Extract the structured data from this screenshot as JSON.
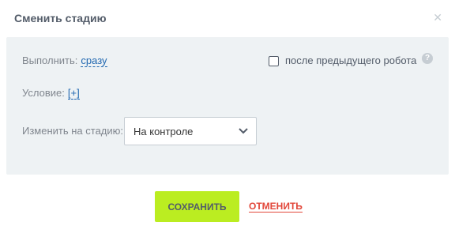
{
  "dialog": {
    "title": "Сменить стадию",
    "close_icon": "close-icon"
  },
  "panel": {
    "execute_label": "Выполнить:",
    "execute_value": "сразу",
    "after_robot_label": "после предыдущего робота",
    "after_robot_checked": false,
    "help_icon": "question-circle-icon",
    "help_glyph": "?",
    "condition_label": "Условие:",
    "condition_value": "[+]",
    "stage_label": "Изменить на стадию:",
    "stage_selected": "На контроле"
  },
  "footer": {
    "save_label": "СОХРАНИТЬ",
    "cancel_label": "ОТМЕНИТЬ"
  },
  "colors": {
    "save_button_bg": "#bbed21",
    "cancel_link": "#e2473a",
    "link_blue": "#2067b0",
    "panel_bg": "#eef2f4"
  }
}
